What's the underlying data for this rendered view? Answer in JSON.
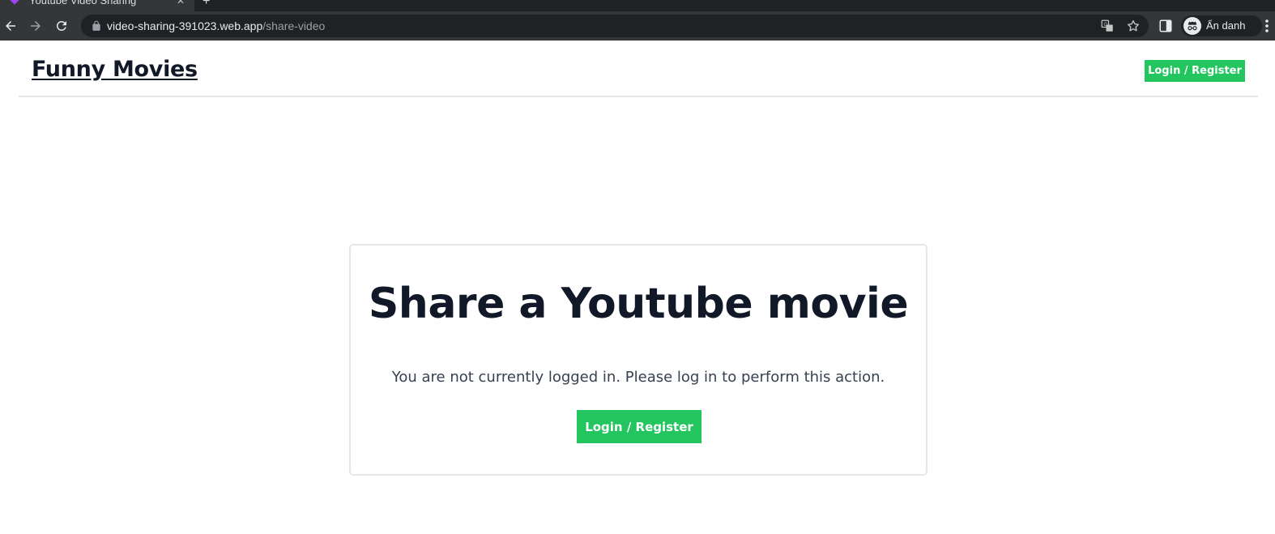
{
  "browser": {
    "tab_title": "Youtube Video Sharing",
    "url_host": "video-sharing-391023.web.app",
    "url_path": "/share-video",
    "incognito_label": "Ẩn danh",
    "icons": [
      "back-icon",
      "forward-icon",
      "reload-icon",
      "lock-icon",
      "translate-icon",
      "star-icon",
      "side-panel-icon",
      "incognito-icon",
      "menu-icon"
    ]
  },
  "header": {
    "logo": "Funny Movies",
    "login_button": "Login / Register"
  },
  "card": {
    "title": "Share a Youtube movie",
    "message": "You are not currently logged in. Please log in to perform this action.",
    "login_button": "Login / Register"
  },
  "colors": {
    "accent_green": "#22c55e",
    "text_dark": "#111827",
    "chrome_dark": "#35363a"
  }
}
